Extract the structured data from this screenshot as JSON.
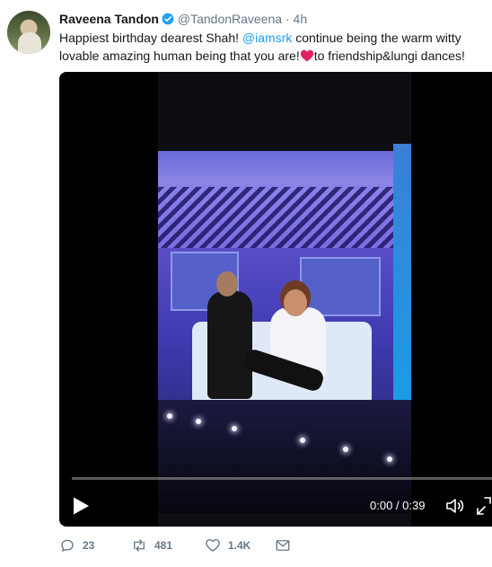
{
  "tweet": {
    "author_name": "Raveena Tandon",
    "handle": "@TandonRaveena",
    "separator": "·",
    "time": "4h",
    "text_before_mention": "Happiest birthday dearest Shah! ",
    "mention": "@iamsrk",
    "text_after_mention": " continue being the warm witty lovable amazing human being that you are!",
    "text_after_heart": "to friendship&lungi dances!"
  },
  "video": {
    "timecode": "0:00 / 0:39",
    "progress": 0
  },
  "actions": {
    "reply_count": "23",
    "retweet_count": "481",
    "like_count": "1.4K"
  },
  "icons": {
    "verified": "verified-badge-icon",
    "heart_emoji": "red-heart-icon",
    "play": "play-icon",
    "volume": "volume-icon",
    "fullscreen": "fullscreen-icon",
    "reply": "reply-icon",
    "retweet": "retweet-icon",
    "like": "heart-icon",
    "dm": "envelope-icon"
  },
  "colors": {
    "link": "#1da1f2",
    "muted": "#657786",
    "text": "#14171a",
    "heart": "#e0245e"
  }
}
